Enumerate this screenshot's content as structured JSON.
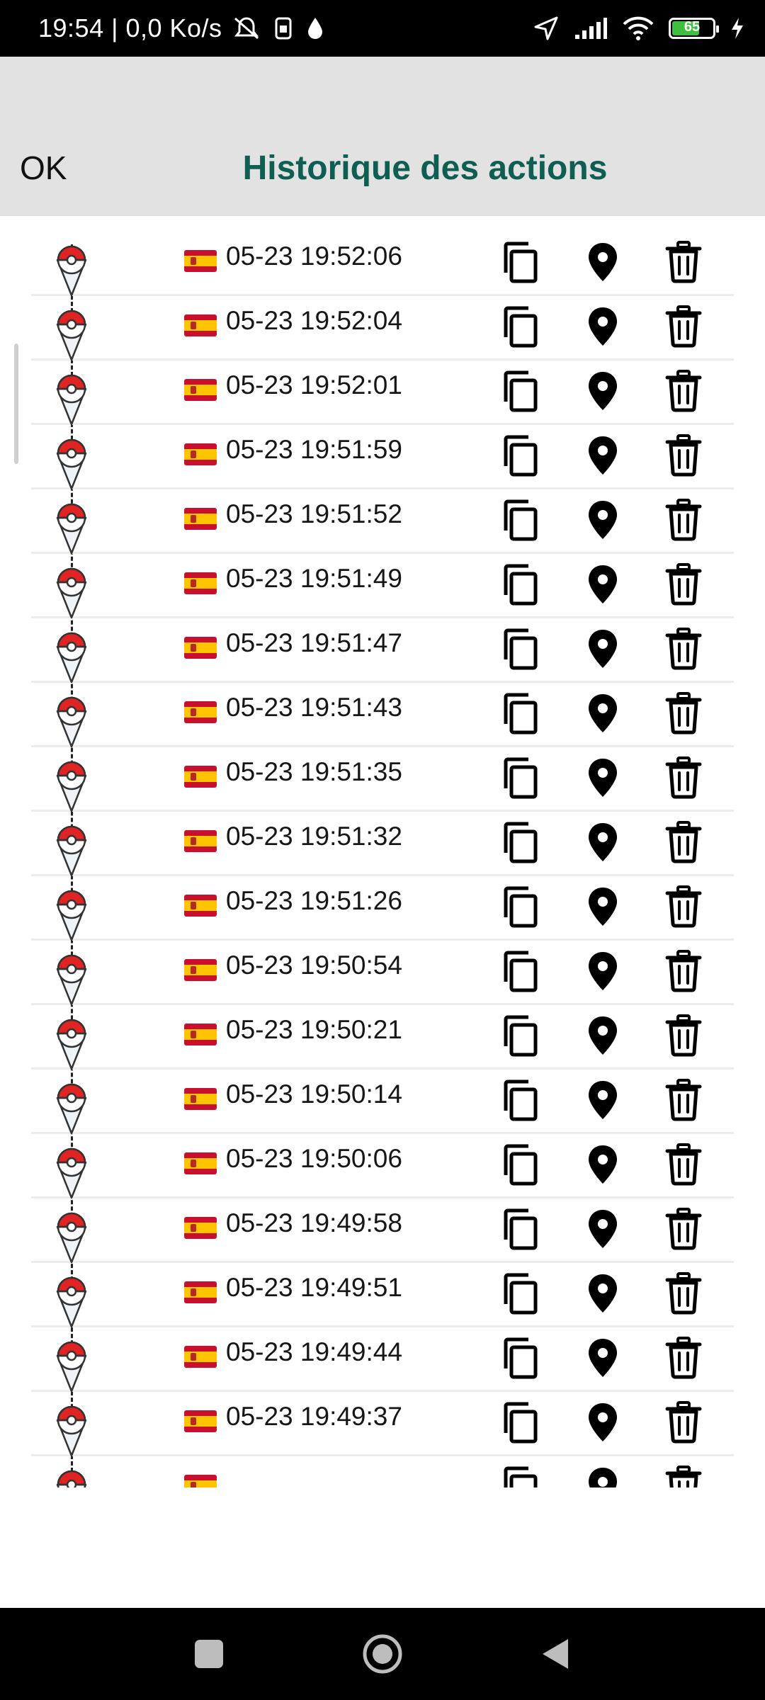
{
  "status_bar": {
    "time_speed": "19:54 | 0,0 Ko/s",
    "battery_level": "65",
    "battery_fill_fraction": 0.65,
    "icons": [
      "mute-icon",
      "sim-icon",
      "drop-icon",
      "location-arrow-icon",
      "signal-icon",
      "wifi-icon",
      "battery-icon",
      "charging-icon"
    ]
  },
  "header": {
    "ok_label": "OK",
    "title": "Historique des actions"
  },
  "colors": {
    "title": "#0f5e52",
    "header_bg": "#e2e2e2",
    "marker_red": "#e02424"
  },
  "history": [
    {
      "timestamp": "05-23 19:52:06"
    },
    {
      "timestamp": "05-23 19:52:04"
    },
    {
      "timestamp": "05-23 19:52:01"
    },
    {
      "timestamp": "05-23 19:51:59"
    },
    {
      "timestamp": "05-23 19:51:52"
    },
    {
      "timestamp": "05-23 19:51:49"
    },
    {
      "timestamp": "05-23 19:51:47"
    },
    {
      "timestamp": "05-23 19:51:43"
    },
    {
      "timestamp": "05-23 19:51:35"
    },
    {
      "timestamp": "05-23 19:51:32"
    },
    {
      "timestamp": "05-23 19:51:26"
    },
    {
      "timestamp": "05-23 19:50:54"
    },
    {
      "timestamp": "05-23 19:50:21"
    },
    {
      "timestamp": "05-23 19:50:14"
    },
    {
      "timestamp": "05-23 19:50:06"
    },
    {
      "timestamp": "05-23 19:49:58"
    },
    {
      "timestamp": "05-23 19:49:51"
    },
    {
      "timestamp": "05-23 19:49:44"
    },
    {
      "timestamp": "05-23 19:49:37"
    },
    {
      "timestamp": ""
    }
  ],
  "row_icons": {
    "marker": "pokeball-pin-icon",
    "flag": "spain-flag-icon",
    "copy": "copy-icon",
    "locate": "map-pin-icon",
    "delete": "trash-icon"
  },
  "nav_bar": {
    "icons": [
      "recents-square-icon",
      "home-circle-icon",
      "back-triangle-icon"
    ]
  }
}
